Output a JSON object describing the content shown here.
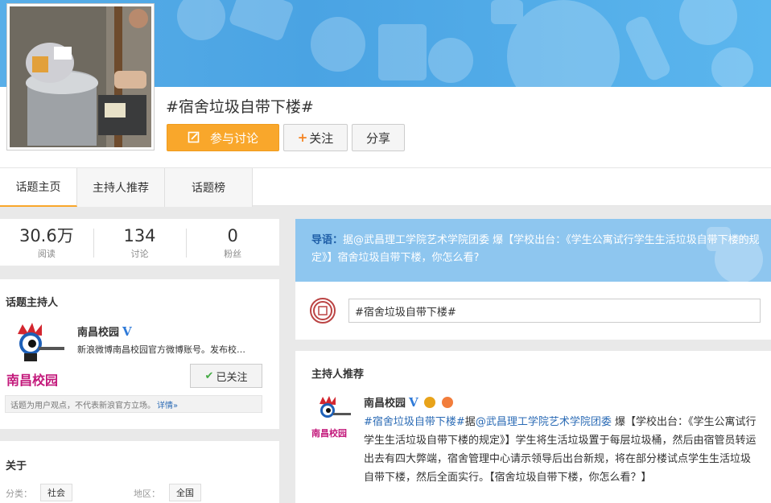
{
  "topic": {
    "title": "#宿舍垃圾自带下楼#",
    "join_label": "参与讨论",
    "follow_label": "关注",
    "share_label": "分享"
  },
  "tabs": [
    "话题主页",
    "主持人推荐",
    "话题榜"
  ],
  "stats": [
    {
      "value": "30.6万",
      "label": "阅读"
    },
    {
      "value": "134",
      "label": "讨论"
    },
    {
      "value": "0",
      "label": "粉丝"
    }
  ],
  "host": {
    "heading": "话题主持人",
    "name": "南昌校园",
    "verified_mark": "V",
    "desc": "新浪微博南昌校园官方微博账号。发布校…",
    "followed_label": "已关注",
    "logo_text": "南昌校园",
    "notice": "话题为用户观点，不代表新浪官方立场。",
    "notice_link": "详情»"
  },
  "about": {
    "heading": "关于",
    "category_key": "分类：",
    "category_value": "社会",
    "region_key": "地区：",
    "region_value": "全国"
  },
  "guide": {
    "lead": "导语：",
    "text": "据@武昌理工学院艺术学院团委 爆【学校出台：《学生公寓试行学生生活垃圾自带下楼的规定》】宿舍垃圾自带下楼，你怎么看?"
  },
  "composer": {
    "value": "#宿舍垃圾自带下楼#"
  },
  "recommend": {
    "heading": "主持人推荐",
    "name": "南昌校园",
    "verified_mark": "V",
    "logo_text": "南昌校园",
    "hashtag": "#宿舍垃圾自带下楼#",
    "prefix": "据",
    "mention": "@武昌理工学院艺术学院团委",
    "body": " 爆【学校出台：《学生公寓试行学生生活垃圾自带下楼的规定》】学生将生活垃圾置于每层垃圾桶，然后由宿管员转运出去有四大弊端，宿舍管理中心请示领导后出台新规，将在部分楼试点学生生活垃圾自带下楼，然后全面实行。【宿舍垃圾自带下楼，你怎么看？】"
  },
  "colors": {
    "accent": "#f9a72b",
    "banner": "#4aa3e3",
    "guide_bg": "#8ec6ef",
    "link": "#2b6bb5",
    "verified": "#2f7ad8"
  }
}
